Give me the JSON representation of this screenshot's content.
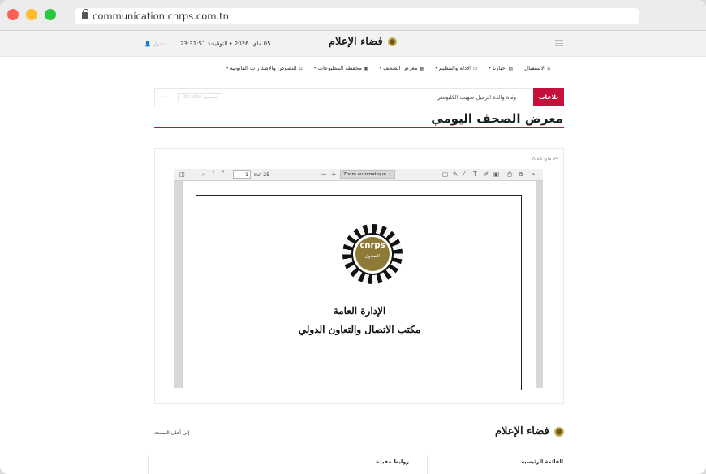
{
  "browser": {
    "url": "communication.cnrps.com.tn"
  },
  "header": {
    "logo_text": "فضاء الإعلام",
    "date_info": "05 ماي، 2026 • التوقيت: 23:31:51",
    "login": "دخول"
  },
  "nav": {
    "items": [
      {
        "label": "الاستقبال",
        "icon": "home-icon",
        "glyph": "⌂",
        "dropdown": false
      },
      {
        "label": "أخبارنا",
        "icon": "news-icon",
        "glyph": "▤",
        "dropdown": true
      },
      {
        "label": "الأدلة والتنظيم",
        "icon": "folder-icon",
        "glyph": "▭",
        "dropdown": true
      },
      {
        "label": "معرض الصحف",
        "icon": "newspaper-icon",
        "glyph": "▦",
        "dropdown": true
      },
      {
        "label": "محفظة المطبوعات",
        "icon": "briefcase-icon",
        "glyph": "▣",
        "dropdown": true
      },
      {
        "label": "النصوص والإصدارات القانونية",
        "icon": "legal-icon",
        "glyph": "⚖",
        "dropdown": true
      }
    ]
  },
  "ticker": {
    "badge": "بلاغات",
    "text": "وفاة والدة الزميل صهيب الكلبوسي",
    "date": "29 ديسمبر 2025"
  },
  "page": {
    "title": "معرض الصحف اليومي",
    "card_date": "04 ماي 2026"
  },
  "viewer": {
    "page_number": "1",
    "page_total": "sur 25",
    "zoom": "Zoom automatique",
    "document": {
      "seal_text": "cnrps",
      "seal_sub": "الصندوق",
      "line1": "الإدارة العامة",
      "line2": "مكتب الاتصال والتعاون الدولي"
    }
  },
  "footer": {
    "logo_text": "فضاء الإعلام",
    "back_to_top": "إلى أعلى الصفحة",
    "col_main_menu": "القائمة الرئيسية",
    "col_links": "روابط مفيدة"
  },
  "colors": {
    "accent": "#c4103a"
  }
}
